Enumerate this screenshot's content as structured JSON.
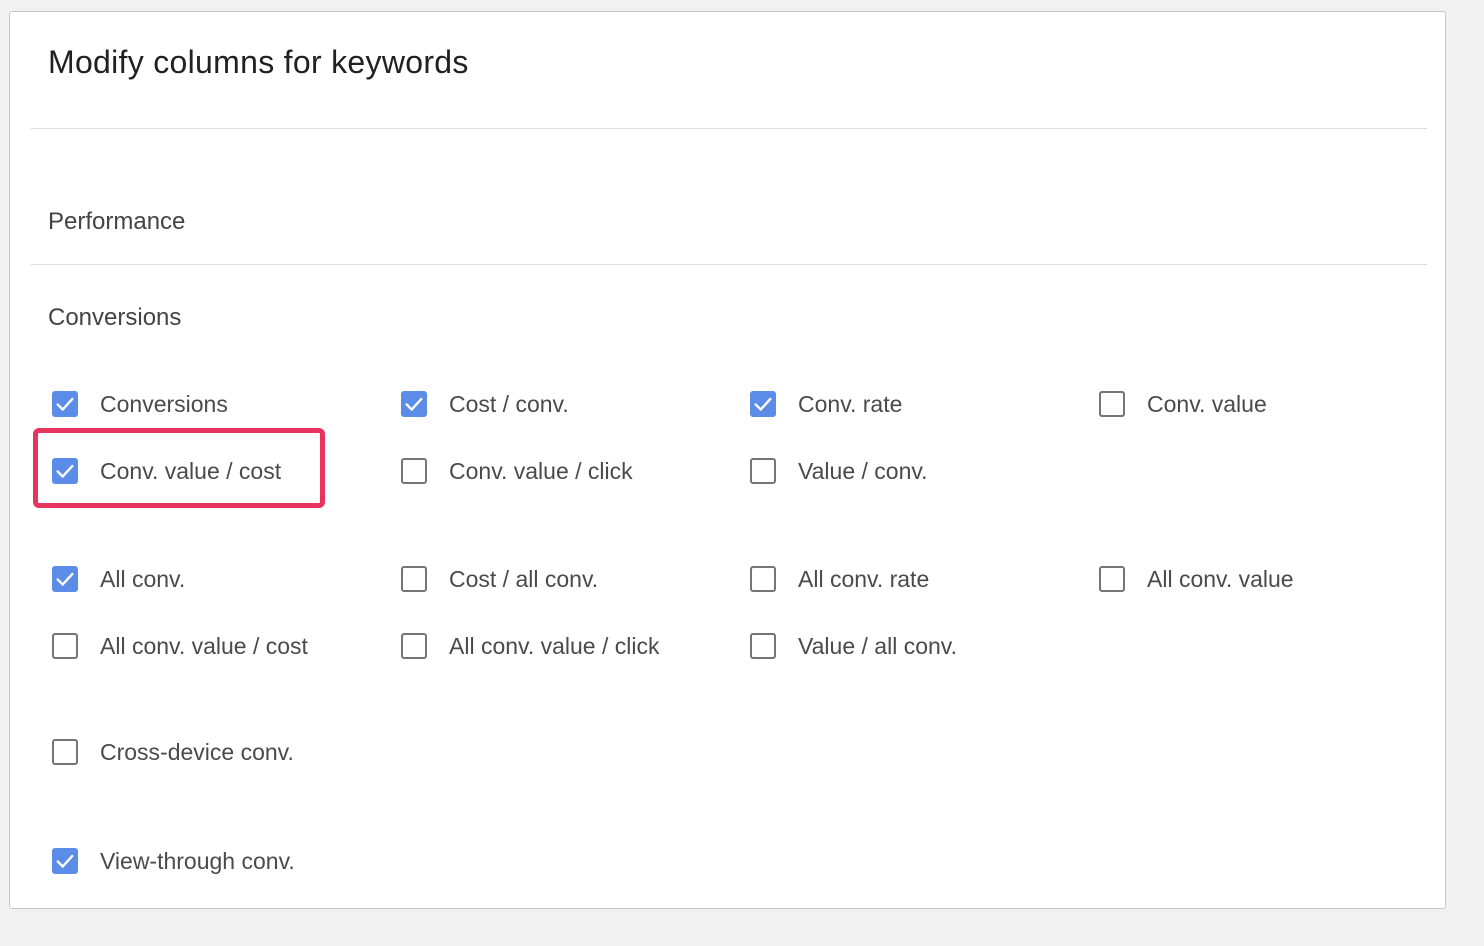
{
  "dialog": {
    "title": "Modify columns for keywords"
  },
  "sections": {
    "performance": "Performance",
    "conversions": "Conversions"
  },
  "options": {
    "conversions": {
      "label": "Conversions",
      "checked": true
    },
    "cost_conv": {
      "label": "Cost / conv.",
      "checked": true
    },
    "conv_rate": {
      "label": "Conv. rate",
      "checked": true
    },
    "conv_value": {
      "label": "Conv. value",
      "checked": false
    },
    "conv_value_cost": {
      "label": "Conv. value / cost",
      "checked": true
    },
    "conv_value_click": {
      "label": "Conv. value / click",
      "checked": false
    },
    "value_conv": {
      "label": "Value / conv.",
      "checked": false
    },
    "all_conv": {
      "label": "All conv.",
      "checked": true
    },
    "cost_all_conv": {
      "label": "Cost / all conv.",
      "checked": false
    },
    "all_conv_rate": {
      "label": "All conv. rate",
      "checked": false
    },
    "all_conv_value": {
      "label": "All conv. value",
      "checked": false
    },
    "all_conv_value_cost": {
      "label": "All conv. value / cost",
      "checked": false
    },
    "all_conv_value_click": {
      "label": "All conv. value / click",
      "checked": false
    },
    "value_all_conv": {
      "label": "Value / all conv.",
      "checked": false
    },
    "cross_device_conv": {
      "label": "Cross-device conv.",
      "checked": false
    },
    "view_through_conv": {
      "label": "View-through conv.",
      "checked": true
    }
  },
  "colors": {
    "checkbox_checked": "#5b8de8",
    "highlight_border": "#e8335f"
  }
}
